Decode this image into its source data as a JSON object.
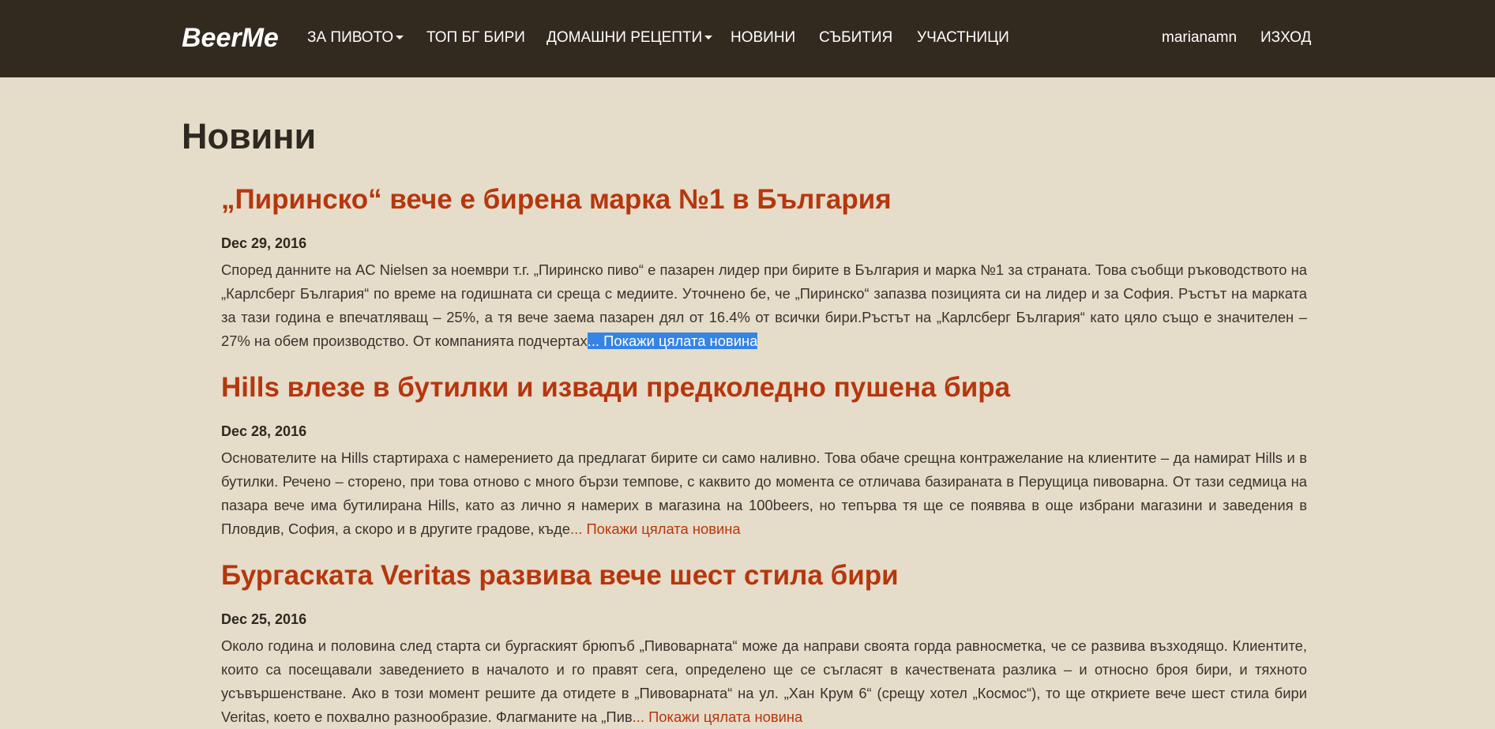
{
  "brand": "BeerMe",
  "nav": {
    "about_beer": "ЗА ПИВОТО",
    "top_bg_beers": "ТОП БГ БИРИ",
    "home_recipes": "ДОМАШНИ РЕЦЕПТИ",
    "news": "НОВИНИ",
    "events": "СЪБИТИЯ",
    "members": "УЧАСТНИЦИ",
    "username": "marianamn",
    "logout": "ИЗХОД"
  },
  "page": {
    "title": "Новини"
  },
  "articles": [
    {
      "title": "„Пиринско“ вече е бирена марка №1 в България",
      "date": "Dec 29, 2016",
      "excerpt": "Според данните на AC Nielsen за ноември т.г. „Пиринско пиво“ е пазарен лидер при бирите в България и марка №1 за страната. Това съобщи ръководството на „Карлсберг България“ по време на годишната си среща с медиите. Уточнено бе, че „Пиринско“ запазва позицията си на лидер и за София. Ръстът на марката за тази година е впечатляващ – 25%, а тя вече заема пазарен дял от 16.4% от всички бири.Ръстът на „Карлсберг България“ като цяло също е значителен – 27% на обем производство. От компанията подчертах",
      "read_more": "... Покажи цялата новина"
    },
    {
      "title": "Hills влезе в бутилки и извади предколедно пушена бира",
      "date": "Dec 28, 2016",
      "excerpt": "Основателите на Hills стартираха с намерението да предлагат бирите си само наливно. Това обаче срещна контражелание на клиентите – да намират Hills и в бутилки. Речено – сторено, при това отново с много бързи темпове, с каквито до момента се отличава базираната в Перущица пивоварна. От тази седмица на пазара вече има бутилирана Hills, като аз лично я намерих в магазина на 100beers, но тепърва тя ще се появява в още избрани магазини и заведения в Пловдив, София, а скоро и в другите градове, къде",
      "read_more": "... Покажи цялата новина"
    },
    {
      "title": "Бургаската Veritas развива вече шест стила бири",
      "date": "Dec 25, 2016",
      "excerpt": "Около година и половина след старта си бургаският брюпъб „Пивоварната“ може да направи своята горда равносметка, че се развива възходящо. Клиентите, които са посещавали заведението в началото и го правят сега, определено ще се съгласят в качествената разлика – и относно броя бири, и тяхното усъвършенстване. Ако в този момент решите да отидете в „Пивоварната“ на ул. „Хан Крум 6“ (срещу хотел „Космос“), то ще откриете вече шест стила бири Veritas, което е похвално разнообразие. Флагманите на „Пив",
      "read_more": "... Покажи цялата новина"
    }
  ]
}
